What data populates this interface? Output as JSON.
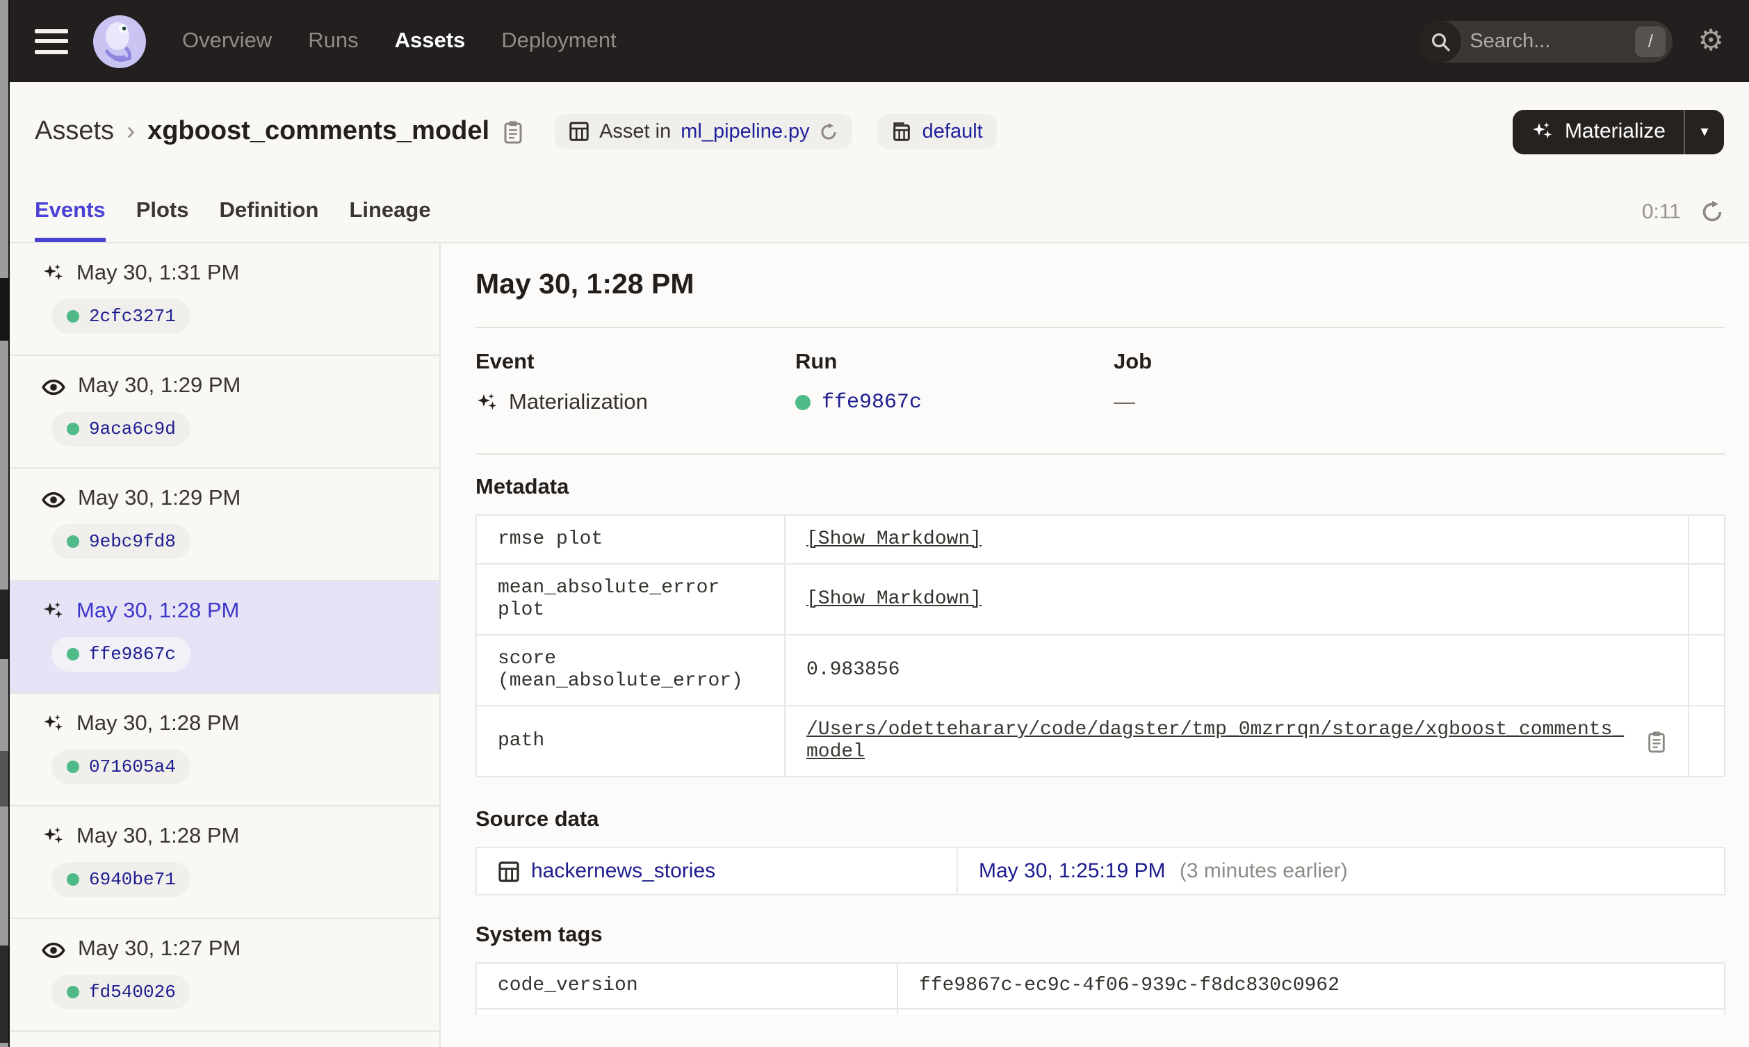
{
  "colors": {
    "nav_bg": "#221f1e",
    "accent_blurple": "#4a42d4",
    "link_navy": "#1e1d8f",
    "status_green": "#4fb988",
    "selected_row_bg": "#e5e3f5"
  },
  "navbar": {
    "items": [
      {
        "label": "Overview",
        "active": false
      },
      {
        "label": "Runs",
        "active": false
      },
      {
        "label": "Assets",
        "active": true
      },
      {
        "label": "Deployment",
        "active": false
      }
    ],
    "search": {
      "placeholder": "Search...",
      "shortcut": "/"
    }
  },
  "header": {
    "breadcrumb_root": "Assets",
    "breadcrumb_sep": "›",
    "asset_name": "xgboost_comments_model",
    "badge_asset_prefix": "Asset in",
    "badge_asset_link": "ml_pipeline.py",
    "badge_repo": "default",
    "materialize_label": "Materialize",
    "materialize_caret": "▾"
  },
  "tabs": {
    "items": [
      {
        "label": "Events",
        "active": true
      },
      {
        "label": "Plots",
        "active": false
      },
      {
        "label": "Definition",
        "active": false
      },
      {
        "label": "Lineage",
        "active": false
      }
    ],
    "timer": "0:11"
  },
  "sidebar": {
    "events": [
      {
        "icon": "materialization",
        "time": "May 30, 1:31 PM",
        "run_id": "2cfc3271",
        "selected": false
      },
      {
        "icon": "observation",
        "time": "May 30, 1:29 PM",
        "run_id": "9aca6c9d",
        "selected": false
      },
      {
        "icon": "observation",
        "time": "May 30, 1:29 PM",
        "run_id": "9ebc9fd8",
        "selected": false
      },
      {
        "icon": "materialization",
        "time": "May 30, 1:28 PM",
        "run_id": "ffe9867c",
        "selected": true
      },
      {
        "icon": "materialization",
        "time": "May 30, 1:28 PM",
        "run_id": "071605a4",
        "selected": false
      },
      {
        "icon": "materialization",
        "time": "May 30, 1:28 PM",
        "run_id": "6940be71",
        "selected": false
      },
      {
        "icon": "observation",
        "time": "May 30, 1:27 PM",
        "run_id": "fd540026",
        "selected": false
      }
    ]
  },
  "detail": {
    "title": "May 30, 1:28 PM",
    "event_label": "Event",
    "event_value": "Materialization",
    "run_label": "Run",
    "run_value": "ffe9867c",
    "job_label": "Job",
    "job_value": "—",
    "metadata": {
      "heading": "Metadata",
      "rows": [
        {
          "key": "rmse plot",
          "value": "[Show Markdown]",
          "kind": "markdown-link"
        },
        {
          "key": "mean_absolute_error plot",
          "value": "[Show Markdown]",
          "kind": "markdown-link"
        },
        {
          "key": "score\n(mean_absolute_error)",
          "value": "0.983856",
          "kind": "text"
        },
        {
          "key": "path",
          "value": "/Users/odetteharary/code/dagster/tmp_0mzrrqn/storage/xgboost_comments_model",
          "kind": "path-link"
        }
      ]
    },
    "source_data": {
      "heading": "Source data",
      "asset_link": "hackernews_stories",
      "time_link": "May 30, 1:25:19 PM",
      "time_note": "(3 minutes earlier)"
    },
    "system_tags": {
      "heading": "System tags",
      "rows": [
        {
          "key": "code_version",
          "value": "ffe9867c-ec9c-4f06-939c-f8dc830c0962"
        }
      ]
    }
  }
}
